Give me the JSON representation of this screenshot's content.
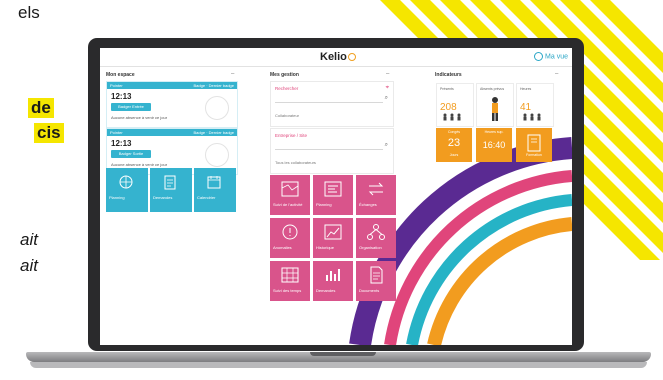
{
  "page_text": {
    "fragment_top": "els",
    "highlight_1": "de",
    "highlight_2": "cis",
    "italic_1": "ait",
    "italic_2": "ait"
  },
  "colors": {
    "stripe_yellow": "#f5e600",
    "accent_blue": "#35b3cf",
    "accent_pink": "#d9548b",
    "accent_orange": "#f29c1f",
    "rainbow_purple": "#5a2a92",
    "rainbow_pink": "#e0457b",
    "rainbow_teal": "#26b3c6",
    "rainbow_orange": "#f29c1f"
  },
  "app": {
    "brand": "Kelio",
    "user_menu": "Ma vue"
  },
  "left_column": {
    "title": "Mon espace",
    "timecards": [
      {
        "head_left": "Pointer",
        "head_right": "Badge · Dernier badge",
        "time": "12:13",
        "button": "Badger Entrée",
        "note": "Aucune absence à venir ce jour"
      },
      {
        "head_left": "Pointer",
        "head_right": "Badge · Dernier badge",
        "time": "12:13",
        "button": "Badger Sortie",
        "note": "Aucune absence à venir ce jour"
      }
    ],
    "tiles": [
      {
        "label": "Planning",
        "icon": "globe-icon"
      },
      {
        "label": "Demandes",
        "icon": "clipboard-icon"
      },
      {
        "label": "Calendrier",
        "icon": "calendar-icon"
      }
    ]
  },
  "middle_column": {
    "title": "Mes gestion",
    "search_cards": [
      {
        "title": "Rechercher",
        "note": "Collaborateur"
      },
      {
        "title": "Entreprise / Site",
        "note": "Tous les collaborateurs"
      }
    ],
    "tiles": [
      {
        "label": "Suivi de l'activité",
        "icon": "map-icon"
      },
      {
        "label": "Planning",
        "icon": "schedule-icon"
      },
      {
        "label": "Échanges",
        "icon": "arrows-icon"
      },
      {
        "label": "Anomalies",
        "icon": "alert-icon"
      },
      {
        "label": "Historique",
        "icon": "chart-icon"
      },
      {
        "label": "Organisation",
        "icon": "network-icon"
      },
      {
        "label": "Suivi des temps",
        "icon": "grid-icon"
      },
      {
        "label": "Demandes",
        "icon": "chart-bar-icon"
      },
      {
        "label": "Documents",
        "icon": "document-icon"
      }
    ]
  },
  "right_column": {
    "title": "Indicateurs",
    "stats": [
      {
        "label": "Présents",
        "value": "208"
      },
      {
        "label": "Absents prévus",
        "value": ""
      },
      {
        "label": "Heures",
        "value": "41"
      }
    ],
    "orange_tiles": [
      {
        "head": "Congés",
        "value": "23",
        "sub": "Jours"
      },
      {
        "head": "Heures sup.",
        "value": "16:40",
        "sub": ""
      },
      {
        "head": "Formation",
        "value": "",
        "sub": ""
      }
    ]
  }
}
